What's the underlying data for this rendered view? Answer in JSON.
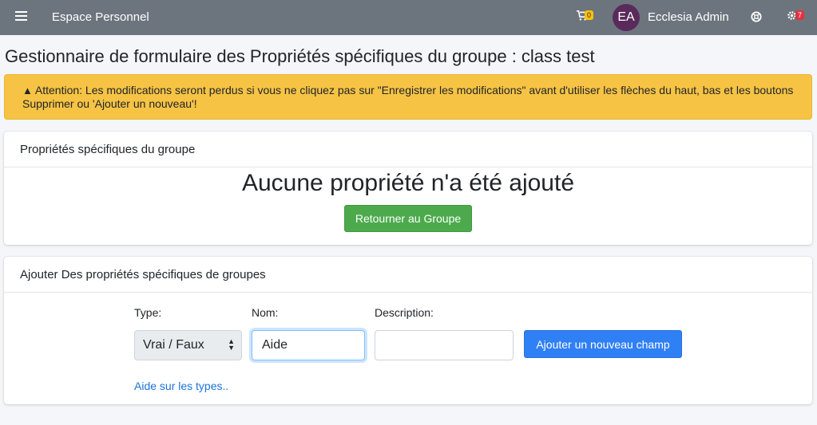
{
  "navbar": {
    "brand": "Espace Personnel",
    "cart_count": "0",
    "avatar_initials": "EA",
    "user_name": "Ecclesia Admin",
    "notifications_count": "7"
  },
  "page": {
    "title": "Gestionnaire de formulaire des Propriétés spécifiques du groupe : class test"
  },
  "alert": {
    "icon": "warning-icon",
    "text": "Attention: Les modifications seront perdus si vous ne cliquez pas sur \"Enregistrer les modifications\" avant d'utiliser les flèches du haut, bas et les boutons Supprimer ou 'Ajouter un nouveau'!"
  },
  "properties_card": {
    "header": "Propriétés spécifiques du groupe",
    "empty_message": "Aucune propriété n'a été ajouté",
    "back_button": "Retourner au Groupe"
  },
  "add_card": {
    "header": "Ajouter Des propriétés spécifiques de groupes",
    "type_label": "Type:",
    "type_value": "Vrai / Faux",
    "name_label": "Nom:",
    "name_value": "Aide",
    "description_label": "Description:",
    "description_value": "",
    "add_button": "Ajouter un nouveau champ",
    "help_link": "Aide sur les types.."
  },
  "colors": {
    "navbar": "#6c757d",
    "alert": "#f6c344",
    "success_button": "#4caa4c",
    "primary_button": "#2f7ff5",
    "link": "#1a73d9"
  }
}
